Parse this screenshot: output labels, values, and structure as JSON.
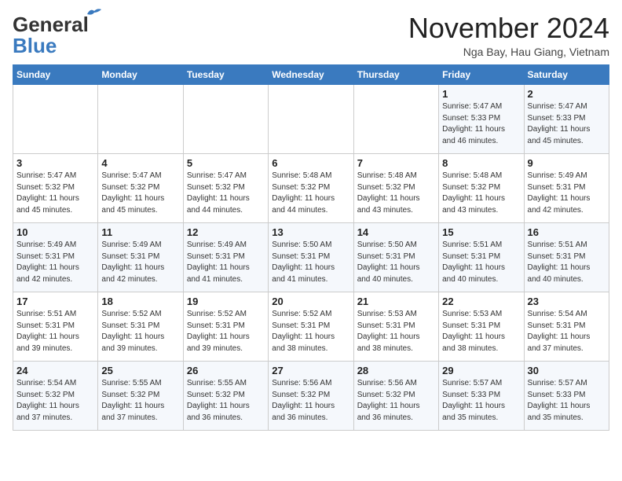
{
  "header": {
    "logo_line1": "General",
    "logo_line2": "Blue",
    "month_title": "November 2024",
    "location": "Nga Bay, Hau Giang, Vietnam"
  },
  "weekdays": [
    "Sunday",
    "Monday",
    "Tuesday",
    "Wednesday",
    "Thursday",
    "Friday",
    "Saturday"
  ],
  "weeks": [
    [
      {
        "day": "",
        "info": ""
      },
      {
        "day": "",
        "info": ""
      },
      {
        "day": "",
        "info": ""
      },
      {
        "day": "",
        "info": ""
      },
      {
        "day": "",
        "info": ""
      },
      {
        "day": "1",
        "info": "Sunrise: 5:47 AM\nSunset: 5:33 PM\nDaylight: 11 hours\nand 46 minutes."
      },
      {
        "day": "2",
        "info": "Sunrise: 5:47 AM\nSunset: 5:33 PM\nDaylight: 11 hours\nand 45 minutes."
      }
    ],
    [
      {
        "day": "3",
        "info": "Sunrise: 5:47 AM\nSunset: 5:32 PM\nDaylight: 11 hours\nand 45 minutes."
      },
      {
        "day": "4",
        "info": "Sunrise: 5:47 AM\nSunset: 5:32 PM\nDaylight: 11 hours\nand 45 minutes."
      },
      {
        "day": "5",
        "info": "Sunrise: 5:47 AM\nSunset: 5:32 PM\nDaylight: 11 hours\nand 44 minutes."
      },
      {
        "day": "6",
        "info": "Sunrise: 5:48 AM\nSunset: 5:32 PM\nDaylight: 11 hours\nand 44 minutes."
      },
      {
        "day": "7",
        "info": "Sunrise: 5:48 AM\nSunset: 5:32 PM\nDaylight: 11 hours\nand 43 minutes."
      },
      {
        "day": "8",
        "info": "Sunrise: 5:48 AM\nSunset: 5:32 PM\nDaylight: 11 hours\nand 43 minutes."
      },
      {
        "day": "9",
        "info": "Sunrise: 5:49 AM\nSunset: 5:31 PM\nDaylight: 11 hours\nand 42 minutes."
      }
    ],
    [
      {
        "day": "10",
        "info": "Sunrise: 5:49 AM\nSunset: 5:31 PM\nDaylight: 11 hours\nand 42 minutes."
      },
      {
        "day": "11",
        "info": "Sunrise: 5:49 AM\nSunset: 5:31 PM\nDaylight: 11 hours\nand 42 minutes."
      },
      {
        "day": "12",
        "info": "Sunrise: 5:49 AM\nSunset: 5:31 PM\nDaylight: 11 hours\nand 41 minutes."
      },
      {
        "day": "13",
        "info": "Sunrise: 5:50 AM\nSunset: 5:31 PM\nDaylight: 11 hours\nand 41 minutes."
      },
      {
        "day": "14",
        "info": "Sunrise: 5:50 AM\nSunset: 5:31 PM\nDaylight: 11 hours\nand 40 minutes."
      },
      {
        "day": "15",
        "info": "Sunrise: 5:51 AM\nSunset: 5:31 PM\nDaylight: 11 hours\nand 40 minutes."
      },
      {
        "day": "16",
        "info": "Sunrise: 5:51 AM\nSunset: 5:31 PM\nDaylight: 11 hours\nand 40 minutes."
      }
    ],
    [
      {
        "day": "17",
        "info": "Sunrise: 5:51 AM\nSunset: 5:31 PM\nDaylight: 11 hours\nand 39 minutes."
      },
      {
        "day": "18",
        "info": "Sunrise: 5:52 AM\nSunset: 5:31 PM\nDaylight: 11 hours\nand 39 minutes."
      },
      {
        "day": "19",
        "info": "Sunrise: 5:52 AM\nSunset: 5:31 PM\nDaylight: 11 hours\nand 39 minutes."
      },
      {
        "day": "20",
        "info": "Sunrise: 5:52 AM\nSunset: 5:31 PM\nDaylight: 11 hours\nand 38 minutes."
      },
      {
        "day": "21",
        "info": "Sunrise: 5:53 AM\nSunset: 5:31 PM\nDaylight: 11 hours\nand 38 minutes."
      },
      {
        "day": "22",
        "info": "Sunrise: 5:53 AM\nSunset: 5:31 PM\nDaylight: 11 hours\nand 38 minutes."
      },
      {
        "day": "23",
        "info": "Sunrise: 5:54 AM\nSunset: 5:31 PM\nDaylight: 11 hours\nand 37 minutes."
      }
    ],
    [
      {
        "day": "24",
        "info": "Sunrise: 5:54 AM\nSunset: 5:32 PM\nDaylight: 11 hours\nand 37 minutes."
      },
      {
        "day": "25",
        "info": "Sunrise: 5:55 AM\nSunset: 5:32 PM\nDaylight: 11 hours\nand 37 minutes."
      },
      {
        "day": "26",
        "info": "Sunrise: 5:55 AM\nSunset: 5:32 PM\nDaylight: 11 hours\nand 36 minutes."
      },
      {
        "day": "27",
        "info": "Sunrise: 5:56 AM\nSunset: 5:32 PM\nDaylight: 11 hours\nand 36 minutes."
      },
      {
        "day": "28",
        "info": "Sunrise: 5:56 AM\nSunset: 5:32 PM\nDaylight: 11 hours\nand 36 minutes."
      },
      {
        "day": "29",
        "info": "Sunrise: 5:57 AM\nSunset: 5:33 PM\nDaylight: 11 hours\nand 35 minutes."
      },
      {
        "day": "30",
        "info": "Sunrise: 5:57 AM\nSunset: 5:33 PM\nDaylight: 11 hours\nand 35 minutes."
      }
    ]
  ]
}
